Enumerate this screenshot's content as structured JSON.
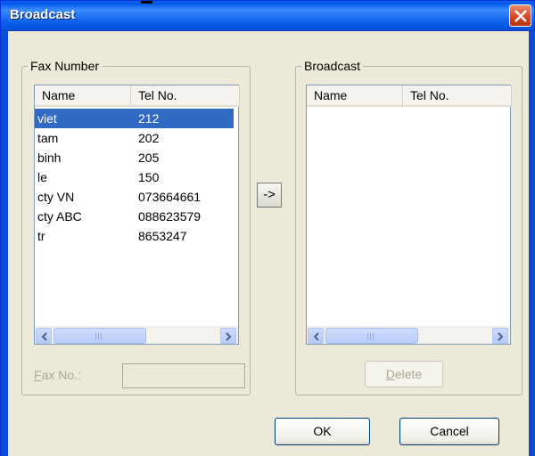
{
  "window": {
    "title": "Broadcast"
  },
  "fax_group": {
    "label": "Fax Number",
    "columns": [
      "Name",
      "Tel No."
    ],
    "rows": [
      {
        "name": "viet",
        "tel": "212",
        "selected": true
      },
      {
        "name": "tam",
        "tel": "202",
        "selected": false
      },
      {
        "name": "binh",
        "tel": "205",
        "selected": false
      },
      {
        "name": "le",
        "tel": "150",
        "selected": false
      },
      {
        "name": "cty VN",
        "tel": "073664661",
        "selected": false
      },
      {
        "name": "cty ABC",
        "tel": "088623579",
        "selected": false
      },
      {
        "name": "tr",
        "tel": "8653247",
        "selected": false
      }
    ],
    "fax_no_label_prefix": "F",
    "fax_no_label_rest": "ax No.:",
    "fax_no_value": ""
  },
  "arrow_label": "->",
  "broadcast_group": {
    "label": "Broadcast",
    "columns": [
      "Name",
      "Tel No."
    ],
    "rows": []
  },
  "buttons": {
    "delete_prefix": "D",
    "delete_rest": "elete",
    "ok": "OK",
    "cancel": "Cancel"
  },
  "colors": {
    "selection": "#316ac5",
    "titlebar": "#0a5fe8",
    "close": "#d0441f"
  }
}
